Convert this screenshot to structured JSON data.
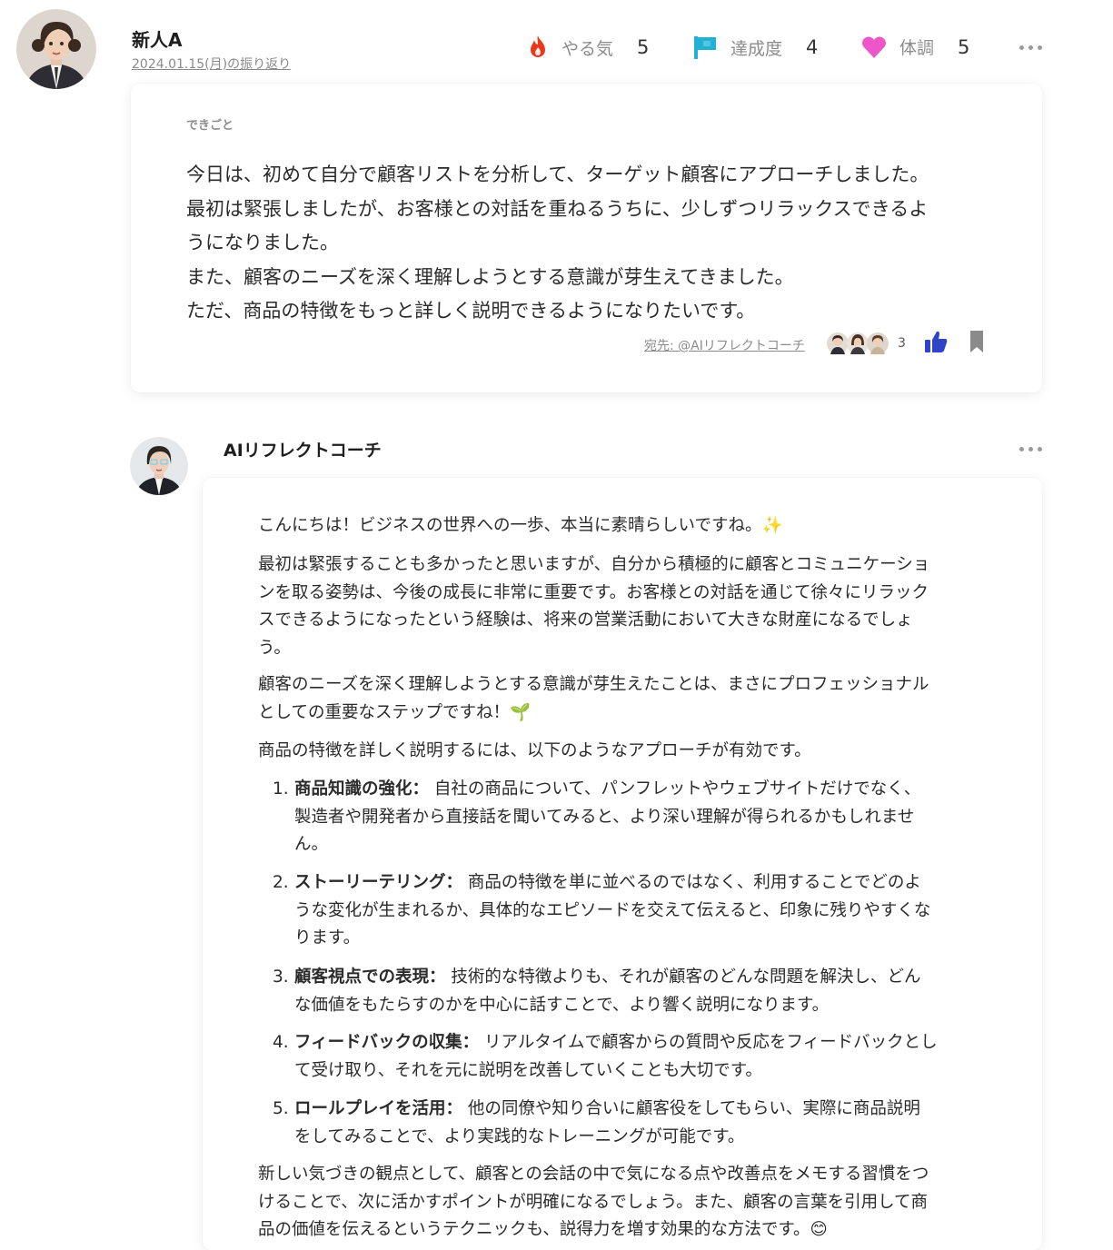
{
  "entry": {
    "author": "新人A",
    "date_link": "2024.01.15(月)の振り返り",
    "metrics": [
      {
        "icon": "fire-icon",
        "label": "やる気",
        "value": "5",
        "color": "#e8391d"
      },
      {
        "icon": "flag-icon",
        "label": "達成度",
        "value": "4",
        "color": "#1fb2d6"
      },
      {
        "icon": "heart-icon",
        "label": "体調",
        "value": "5",
        "color": "#ee55c8"
      }
    ],
    "section_label": "できごと",
    "lines": [
      "今日は、初めて自分で顧客リストを分析して、ターゲット顧客にアプローチしました。",
      "最初は緊張しましたが、お客様との対話を重ねるうちに、少しずつリラックスできるよ",
      "うになりました。",
      "また、顧客のニーズを深く理解しようとする意識が芽生えてきました。",
      "ただ、商品の特徴をもっと詳しく説明できるようになりたいです。"
    ],
    "addressee": "宛先: @AIリフレクトコーチ",
    "reaction_count": "3",
    "like_color": "#2f45c8",
    "bookmark_color": "#8a8a8a"
  },
  "reply": {
    "author": "AIリフレクトコーチ",
    "p1": "こんにちは！ビジネスの世界への一歩、本当に素晴らしいですね。✨",
    "p2_lines": [
      "最初は緊張することも多かったと思いますが、自分から積極的に顧客とコミュニケーショ",
      "ンを取る姿勢は、今後の成長に非常に重要です。お客様との対話を通じて徐々にリラック",
      "スできるようになったという経験は、将来の営業活動において大きな財産になるでしょ",
      "う。"
    ],
    "p3_lines": [
      "顧客のニーズを深く理解しようとする意識が芽生えたことは、まさにプロフェッショナル",
      "としての重要なステップですね！🌱"
    ],
    "p4": "商品の特徴を詳しく説明するには、以下のようなアプローチが有効です。",
    "items": [
      {
        "num": "1.",
        "title": "商品知識の強化：",
        "lines": [
          "自社の商品について、パンフレットやウェブサイトだけでなく、",
          "製造者や開発者から直接話を聞いてみると、より深い理解が得られるかもしれませ",
          "ん。"
        ]
      },
      {
        "num": "2.",
        "title": "ストーリーテリング：",
        "lines": [
          "商品の特徴を単に並べるのではなく、利用することでどのよ",
          "うな変化が生まれるか、具体的なエピソードを交えて伝えると、印象に残りやすくな",
          "ります。"
        ]
      },
      {
        "num": "3.",
        "title": "顧客視点での表現：",
        "lines": [
          "技術的な特徴よりも、それが顧客のどんな問題を解決し、どん",
          "な価値をもたらすのかを中心に話すことで、より響く説明になります。"
        ]
      },
      {
        "num": "4.",
        "title": "フィードバックの収集：",
        "lines": [
          "リアルタイムで顧客からの質問や反応をフィードバックとし",
          "て受け取り、それを元に説明を改善していくことも大切です。"
        ]
      },
      {
        "num": "5.",
        "title": "ロールプレイを活用：",
        "lines": [
          "他の同僚や知り合いに顧客役をしてもらい、実際に商品説明",
          "をしてみることで、より実践的なトレーニングが可能です。"
        ]
      }
    ],
    "p5_lines": [
      "新しい気づきの観点として、顧客との会話の中で気になる点や改善点をメモする習慣をつ",
      "けることで、次に活かすポイントが明確になるでしょう。また、顧客の言葉を引用して商",
      "品の価値を伝えるというテクニックも、説得力を増す効果的な方法です。😊"
    ]
  }
}
